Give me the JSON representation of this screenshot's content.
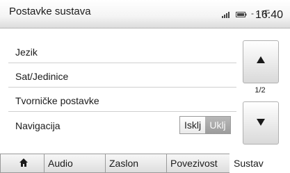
{
  "header": {
    "title": "Postavke sustava",
    "temperature": "- - °F",
    "time": "16:40"
  },
  "icons": {
    "signal": "signal-strength-icon",
    "battery": "battery-icon",
    "home": "home-icon"
  },
  "menu": {
    "items": [
      {
        "label": "Jezik"
      },
      {
        "label": "Sat/Jedinice"
      },
      {
        "label": "Tvorničke postavke"
      },
      {
        "label": "Navigacija",
        "toggle": {
          "off": "Isklj",
          "on": "Uklj",
          "selected": "Uklj"
        }
      }
    ]
  },
  "pager": {
    "indicator": "1/2"
  },
  "tabs": [
    {
      "label": "",
      "icon": "home-icon"
    },
    {
      "label": "Audio"
    },
    {
      "label": "Zaslon"
    },
    {
      "label": "Povezivost"
    },
    {
      "label": "Sustav",
      "active": true
    }
  ],
  "colors": {
    "toggle_on": "#a8a8a8",
    "header_bottom": "#dcdcdc"
  }
}
